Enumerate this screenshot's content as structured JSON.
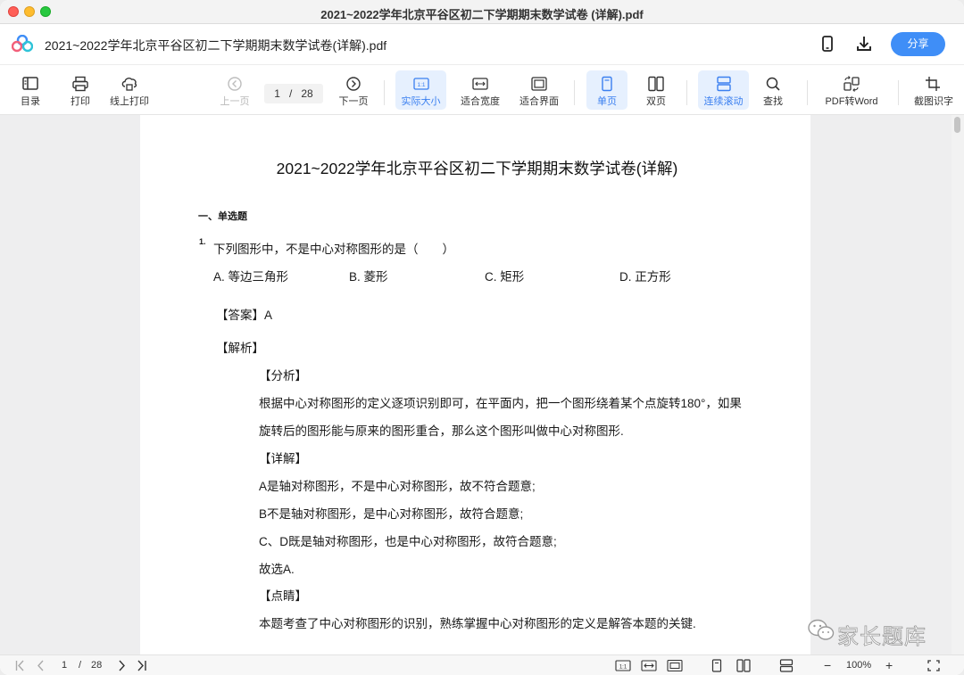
{
  "window": {
    "title": "2021~2022学年北京平谷区初二下学期期末数学试卷 (详解).pdf"
  },
  "header": {
    "doc_title": "2021~2022学年北京平谷区初二下学期期末数学试卷(详解).pdf",
    "share_label": "分享"
  },
  "toolbar": {
    "toc": "目录",
    "print": "打印",
    "online_print": "线上打印",
    "prev": "上一页",
    "page_current": "1",
    "page_total": "28",
    "page_sep": "/",
    "next": "下一页",
    "actual_size": "实际大小",
    "actual_size_icon_text": "1:1",
    "fit_width": "适合宽度",
    "fit_page": "适合界面",
    "single": "单页",
    "double": "双页",
    "continuous": "连续滚动",
    "search": "查找",
    "pdf_to_word": "PDF转Word",
    "ocr": "截图识字"
  },
  "document": {
    "heading": "2021~2022学年北京平谷区初二下学期期末数学试卷(详解)",
    "section": "一、单选题",
    "q1_num": "1.",
    "q1_text": "下列图形中，不是中心对称图形的是（　　）",
    "options": [
      "A. 等边三角形",
      "B. 菱形",
      "C. 矩形",
      "D. 正方形"
    ],
    "answer": "【答案】A",
    "analysis_title": "【解析】",
    "fenxi": "【分析】",
    "fenxi_line1": "根据中心对称图形的定义逐项识别即可，在平面内，把一个图形绕着某个点旋转180°，如果",
    "fenxi_line2": "旋转后的图形能与原来的图形重合，那么这个图形叫做中心对称图形.",
    "xiangjie": "【详解】",
    "xj_line1": "A是轴对称图形，不是中心对称图形，故不符合题意;",
    "xj_line2": "B不是轴对称图形，是中心对称图形，故符合题意;",
    "xj_line3": "C、D既是轴对称图形，也是中心对称图形，故符合题意;",
    "xj_line4": "故选A.",
    "dianjing": "【点睛】",
    "dj_line1": "本题考查了中心对称图形的识别，熟练掌握中心对称图形的定义是解答本题的关键."
  },
  "bottom": {
    "page_current": "1",
    "page_sep": "/",
    "page_total": "28",
    "zoom": "100%",
    "zoom_minus": "−",
    "zoom_plus": "+",
    "actual_icon_text": "1:1"
  },
  "watermark": {
    "text": "家长题库"
  },
  "colors": {
    "accent": "#3f8ef7",
    "active_bg": "#e6f0fe",
    "traffic_red": "#ff5f57",
    "traffic_yellow": "#febc2e",
    "traffic_green": "#28c840"
  }
}
